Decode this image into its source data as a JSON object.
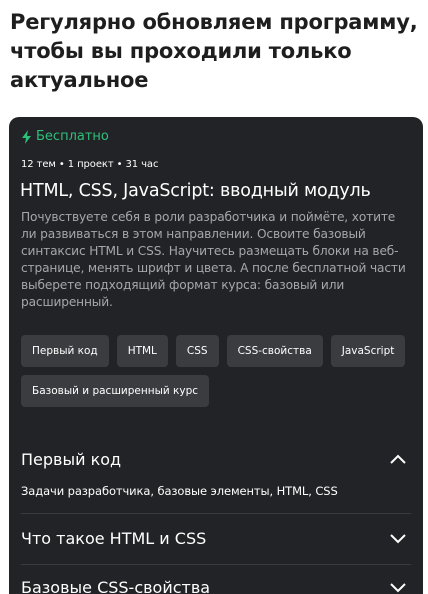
{
  "heading": "Регулярно обновляем программу, чтобы вы проходили только актуальное",
  "card": {
    "badge": "Бесплатно",
    "meta": "12 тем • 1 проект • 31 час",
    "title": "HTML, CSS, JavaScript: вводный модуль",
    "description": "Почувствуете себя в роли разработчика и поймёте, хотите ли развиваться в этом направлении. Освоите базовый синтаксис HTML и CSS. Научитесь размещать блоки на веб-странице, менять шрифт и цвета. А после бесплатной части выберете подходящий формат курса: базовый или расширенный.",
    "tags": [
      "Первый код",
      "HTML",
      "CSS",
      "CSS-свойства",
      "JavaScript",
      "Базовый и расширенный курс"
    ],
    "colors": {
      "card_bg": "#222326",
      "badge": "#2ebf79",
      "tag_bg": "#3b3c40",
      "desc": "#a6a7ab"
    }
  },
  "accordion": [
    {
      "title": "Первый код",
      "body": "Задачи разработчика, базовые элементы, HTML, CSS",
      "expanded": true,
      "icon": "chevron-up-icon"
    },
    {
      "title": "Что такое HTML и CSS",
      "expanded": false,
      "icon": "chevron-down-icon"
    },
    {
      "title": "Базовые CSS-свойства",
      "expanded": false,
      "icon": "chevron-down-icon"
    }
  ]
}
